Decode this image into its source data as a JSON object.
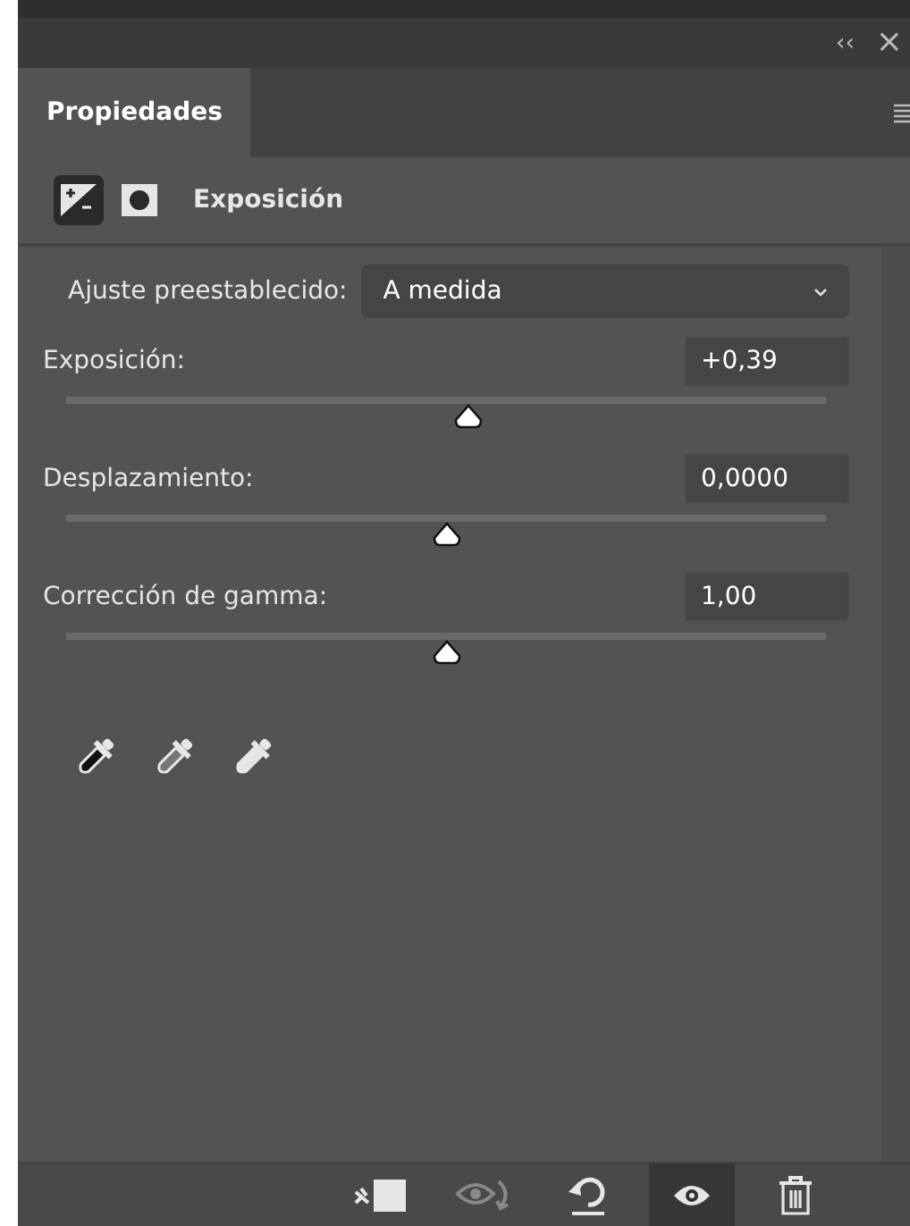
{
  "header": {
    "collapse": "‹‹",
    "close": "×"
  },
  "tabs": [
    {
      "label": "Propiedades",
      "selected": true
    }
  ],
  "mode_buttons": [
    {
      "kind": "adjustment",
      "selected": true
    },
    {
      "kind": "mask",
      "selected": false
    }
  ],
  "title": "Exposición",
  "preset": {
    "label": "Ajuste preestablecido:",
    "value": "A medida"
  },
  "sliders": [
    {
      "label": "Exposición:",
      "value": "+0,39",
      "level": 0.53
    },
    {
      "label": "Desplazamiento:",
      "value": "0,0000",
      "level": 0.5
    },
    {
      "label": "Corrección de gamma:",
      "value": "1,00",
      "level": 0.5
    }
  ],
  "eyedroppers": [
    {
      "kind": "black"
    },
    {
      "kind": "gray"
    },
    {
      "kind": "white"
    }
  ],
  "toolbar": [
    {
      "kind": "clip",
      "disabled": false,
      "selected": false
    },
    {
      "kind": "previous",
      "disabled": true,
      "selected": false
    },
    {
      "kind": "reset",
      "disabled": false,
      "selected": false
    },
    {
      "kind": "visibility",
      "disabled": false,
      "selected": true
    },
    {
      "kind": "delete",
      "disabled": false,
      "selected": false
    }
  ]
}
